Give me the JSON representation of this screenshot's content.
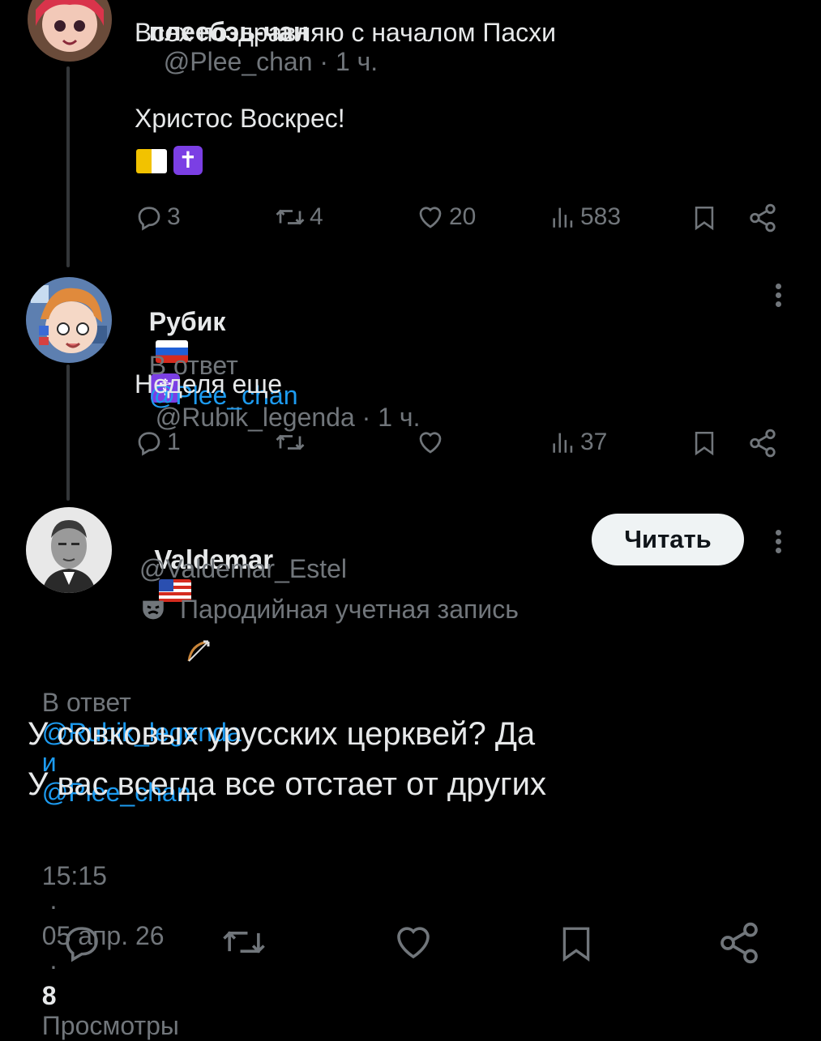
{
  "tweet1": {
    "author_partial": "плеебэь-чан",
    "handle_partial": "@Plee_chan · 1 ч.",
    "line1": "Всех поздравляю с началом Пасхи",
    "line2": "Христос Воскрес!",
    "replies": "3",
    "retweets": "4",
    "likes": "20",
    "views": "583"
  },
  "tweet2": {
    "author": "Рубик",
    "handle_time": "@Rubik_legenda · 1 ч.",
    "reply_prefix": "В ответ",
    "reply_to": "@Plee_chan",
    "body": "Неделя еще",
    "replies": "1",
    "views": "37"
  },
  "main_tweet": {
    "author": "Valdemar",
    "handle": "@Valdemar_Estel",
    "parody_label": "Пародийная учетная запись",
    "follow_label": "Читать",
    "reply_prefix": "В ответ",
    "reply_to_1": "@Rubik_legenda",
    "reply_and": "и",
    "reply_to_2": "@Plee_chan",
    "body_line1": "У совковых урусских церквей? Да",
    "body_line2": "У вас всегда все отстает от других",
    "time": "15:15",
    "date": "05 апр. 26",
    "views_count": "8",
    "views_label": "Просмотры"
  },
  "icons": [
    "reply-icon",
    "retweet-icon",
    "like-icon",
    "views-icon",
    "bookmark-icon",
    "share-icon",
    "more-icon",
    "parody-mask-icon"
  ],
  "colors": {
    "background": "#000000",
    "text": "#e7e9ea",
    "muted": "#71767b",
    "link": "#1d9bf0",
    "follow_bg": "#eff3f4"
  }
}
